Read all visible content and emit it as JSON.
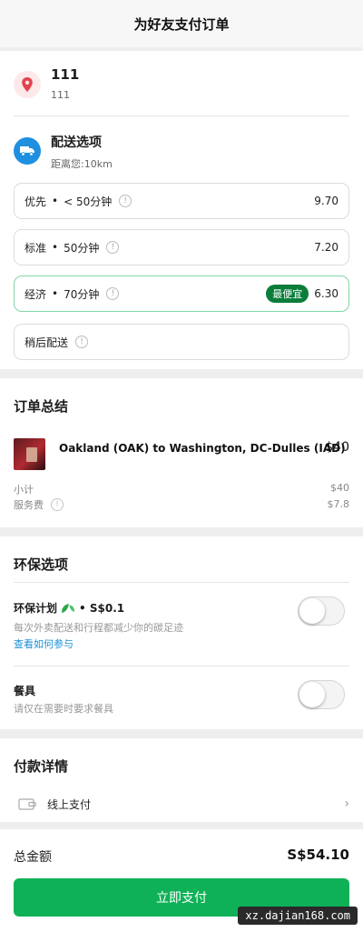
{
  "header": {
    "title": "为好友支付订单"
  },
  "address": {
    "title": "111",
    "subtitle": "111"
  },
  "delivery": {
    "title": "配送选项",
    "distance": "距离您:10km",
    "options": [
      {
        "label": "优先",
        "time": "< 50分钟",
        "price": "9.70"
      },
      {
        "label": "标准",
        "time": "50分钟",
        "price": "7.20"
      },
      {
        "label": "经济",
        "time": "70分钟",
        "badge": "最便宜",
        "price": "6.30",
        "selected": true
      },
      {
        "label": "稍后配送"
      }
    ]
  },
  "summary": {
    "title": "订单总结",
    "item": {
      "name": "Oakland (OAK) to Washington, DC-Dulles (IAD)",
      "price": "$40"
    },
    "subtotal_label": "小计",
    "subtotal_value": "$40",
    "fee_label": "服务费",
    "fee_value": "$7.8"
  },
  "eco": {
    "title": "环保选项",
    "plan_label": "环保计划",
    "plan_price": "• S$0.1",
    "plan_desc": "每次外卖配送和行程都减少你的碳足迹",
    "plan_link": "查看如何参与",
    "plan_enabled": false,
    "cutlery_label": "餐具",
    "cutlery_desc": "请仅在需要时要求餐具",
    "cutlery_enabled": false
  },
  "payment": {
    "title": "付款详情",
    "method": "线上支付"
  },
  "footer": {
    "total_label": "总金额",
    "total_value": "S$54.10",
    "pay_button": "立即支付"
  },
  "watermark": "xz.dajian168.com",
  "colors": {
    "primary": "#0fb157",
    "badge": "#0b7d3b",
    "link": "#1a8fd6",
    "location": "#e2434d",
    "delivery": "#1f8fe0"
  }
}
